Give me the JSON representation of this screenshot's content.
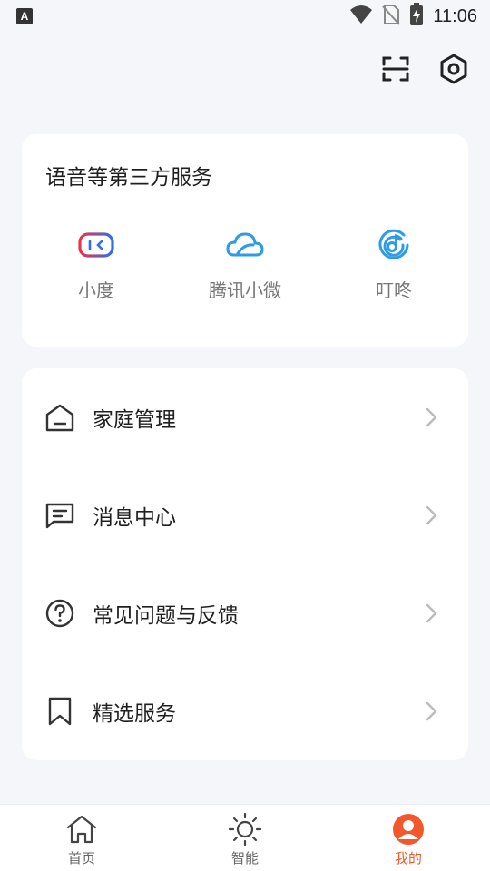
{
  "status_bar": {
    "notification_badge": "A",
    "time": "11:06",
    "icons": [
      "wifi-icon",
      "no-sim-icon",
      "battery-charging-icon"
    ]
  },
  "top_actions": {
    "icons": [
      "scan-icon",
      "settings-icon"
    ]
  },
  "voice_services": {
    "title": "语音等第三方服务",
    "items": [
      {
        "label": "小度",
        "icon": "xiaodu-icon",
        "colors": [
          "#e8344a",
          "#2f6fe8"
        ]
      },
      {
        "label": "腾讯小微",
        "icon": "tencent-xiaowei-icon",
        "color": "#2d9ce8"
      },
      {
        "label": "叮咚",
        "icon": "dingdong-icon",
        "color": "#2d9ce8"
      }
    ]
  },
  "menu": {
    "items": [
      {
        "label": "家庭管理",
        "icon": "home-manage-icon"
      },
      {
        "label": "消息中心",
        "icon": "message-icon"
      },
      {
        "label": "常见问题与反馈",
        "icon": "help-icon"
      },
      {
        "label": "精选服务",
        "icon": "bookmark-icon"
      }
    ]
  },
  "tabbar": {
    "tabs": [
      {
        "label": "首页",
        "icon": "home-icon",
        "active": false
      },
      {
        "label": "智能",
        "icon": "sun-icon",
        "active": false
      },
      {
        "label": "我的",
        "icon": "profile-icon",
        "active": true
      }
    ],
    "active_color": "#f2582c"
  }
}
